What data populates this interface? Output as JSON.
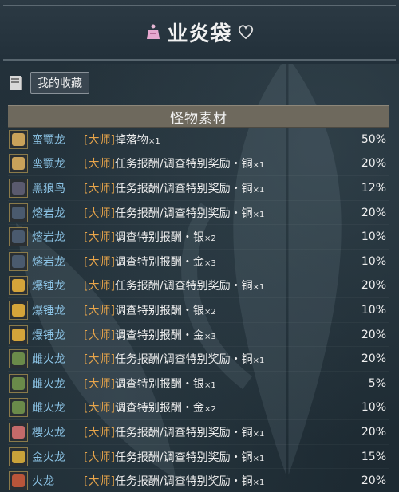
{
  "title": "业炎袋",
  "favorites_label": "我的收藏",
  "section_title": "怪物素材",
  "rank_label": "[大师]",
  "rows": [
    {
      "monster": "蛮颚龙",
      "desc": "掉落物",
      "qty": "×1",
      "pct": "50%",
      "icon_color": "#c9a25a"
    },
    {
      "monster": "蛮颚龙",
      "desc": "任务报酬/调查特别奖励・铜",
      "qty": "×1",
      "pct": "20%",
      "icon_color": "#c9a25a"
    },
    {
      "monster": "黑狼鸟",
      "desc": "任务报酬/调查特别奖励・铜",
      "qty": "×1",
      "pct": "12%",
      "icon_color": "#5a5a6e"
    },
    {
      "monster": "熔岩龙",
      "desc": "任务报酬/调查特别奖励・铜",
      "qty": "×1",
      "pct": "20%",
      "icon_color": "#4a5a6e"
    },
    {
      "monster": "熔岩龙",
      "desc": "调查特别报酬・银",
      "qty": "×2",
      "pct": "10%",
      "icon_color": "#4a5a6e"
    },
    {
      "monster": "熔岩龙",
      "desc": "调查特别报酬・金",
      "qty": "×3",
      "pct": "10%",
      "icon_color": "#4a5a6e"
    },
    {
      "monster": "爆锤龙",
      "desc": "任务报酬/调查特别奖励・铜",
      "qty": "×1",
      "pct": "20%",
      "icon_color": "#d4a43a"
    },
    {
      "monster": "爆锤龙",
      "desc": "调查特别报酬・银",
      "qty": "×2",
      "pct": "10%",
      "icon_color": "#d4a43a"
    },
    {
      "monster": "爆锤龙",
      "desc": "调查特别报酬・金",
      "qty": "×3",
      "pct": "20%",
      "icon_color": "#d4a43a"
    },
    {
      "monster": "雌火龙",
      "desc": "任务报酬/调查特别奖励・铜",
      "qty": "×1",
      "pct": "20%",
      "icon_color": "#6a8a4a"
    },
    {
      "monster": "雌火龙",
      "desc": "调查特别报酬・银",
      "qty": "×1",
      "pct": "5%",
      "icon_color": "#6a8a4a"
    },
    {
      "monster": "雌火龙",
      "desc": "调查特别报酬・金",
      "qty": "×2",
      "pct": "10%",
      "icon_color": "#6a8a4a"
    },
    {
      "monster": "樱火龙",
      "desc": "任务报酬/调查特别奖励・铜",
      "qty": "×1",
      "pct": "20%",
      "icon_color": "#c46a6a"
    },
    {
      "monster": "金火龙",
      "desc": "任务报酬/调查特别奖励・铜",
      "qty": "×1",
      "pct": "15%",
      "icon_color": "#c9a23a"
    },
    {
      "monster": "火龙",
      "desc": "任务报酬/调查特别奖励・铜",
      "qty": "×1",
      "pct": "20%",
      "icon_color": "#b8553a"
    }
  ]
}
